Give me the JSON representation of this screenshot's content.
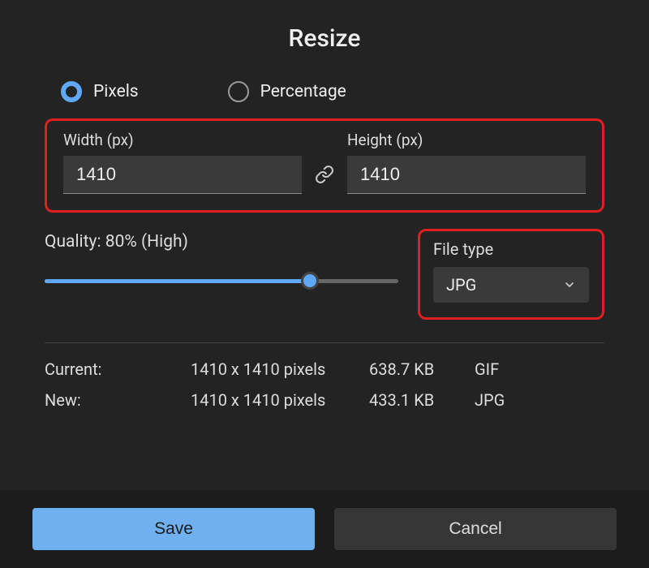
{
  "title": "Resize",
  "mode": {
    "pixels_label": "Pixels",
    "percentage_label": "Percentage",
    "selected": "pixels"
  },
  "dimensions": {
    "width_label": "Width  (px)",
    "height_label": "Height  (px)",
    "width_value": "1410",
    "height_value": "1410"
  },
  "quality": {
    "label": "Quality: 80% (High)",
    "percent": 80
  },
  "filetype": {
    "label": "File type",
    "value": "JPG"
  },
  "info": {
    "current_label": "Current:",
    "current_dims": "1410 x 1410 pixels",
    "current_size": "638.7 KB",
    "current_format": "GIF",
    "new_label": "New:",
    "new_dims": "1410 x 1410 pixels",
    "new_size": "433.1 KB",
    "new_format": "JPG"
  },
  "buttons": {
    "save": "Save",
    "cancel": "Cancel"
  }
}
